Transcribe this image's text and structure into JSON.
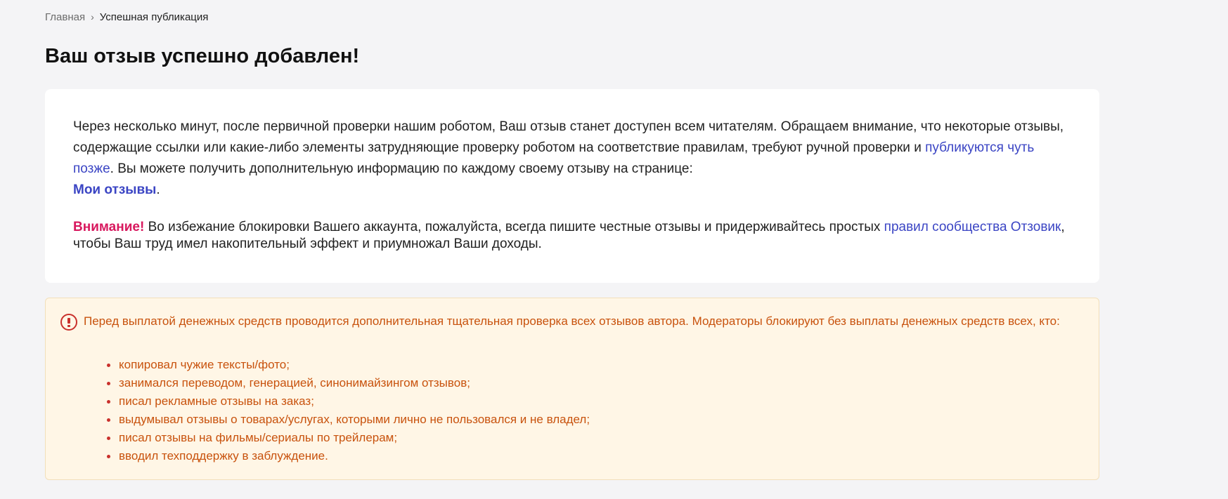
{
  "breadcrumb": {
    "home": "Главная",
    "separator": "›",
    "current": "Успешная публикация"
  },
  "page": {
    "title": "Ваш отзыв успешно добавлен!"
  },
  "info": {
    "text_before_link": "Через несколько минут, после первичной проверки нашим роботом, Ваш отзыв станет доступен всем читателям. Обращаем внимание, что некоторые отзывы, содержащие ссылки или какие-либо элементы затрудняющие проверку роботом на соответствие правилам, требуют ручной проверки и ",
    "later_link": "публикуются чуть позже",
    "text_after_link": ". Вы можете получить дополнительную информацию по каждому своему отзыву на странице: ",
    "my_reviews_link": "Мои отзывы",
    "text_end": "."
  },
  "notice": {
    "attention_label": "Внимание!",
    "text_before_link": " Во избежание блокировки Вашего аккаунта, пожалуйста, всегда пишите честные отзывы и придерживайтесь простых ",
    "rules_link": "правил сообщества Отзовик",
    "text_after_link": ", чтобы Ваш труд имел накопительный эффект и приумножал Ваши доходы."
  },
  "warning": {
    "icon": "exclamation-circle-icon",
    "intro": "Перед выплатой денежных средств проводится дополнительная тщательная проверка всех отзывов автора. Модераторы блокируют без выплаты денежных средств всех, кто:",
    "items": [
      "копировал чужие тексты/фото;",
      "занимался переводом, генерацией, синонимайзингом отзывов;",
      "писал рекламные отзывы на заказ;",
      "выдумывал отзывы о товарах/услугах, которыми лично не пользовался и не владел;",
      "писал отзывы на фильмы/сериалы по трейлерам;",
      "вводил техподдержку в заблуждение."
    ]
  },
  "colors": {
    "page_background": "#f4f4f6",
    "card_background": "#ffffff",
    "link": "#3b45c4",
    "attention": "#d8185e",
    "warning_background": "#fff6e6",
    "warning_text": "#c8520d",
    "warning_icon": "#c9302c"
  }
}
